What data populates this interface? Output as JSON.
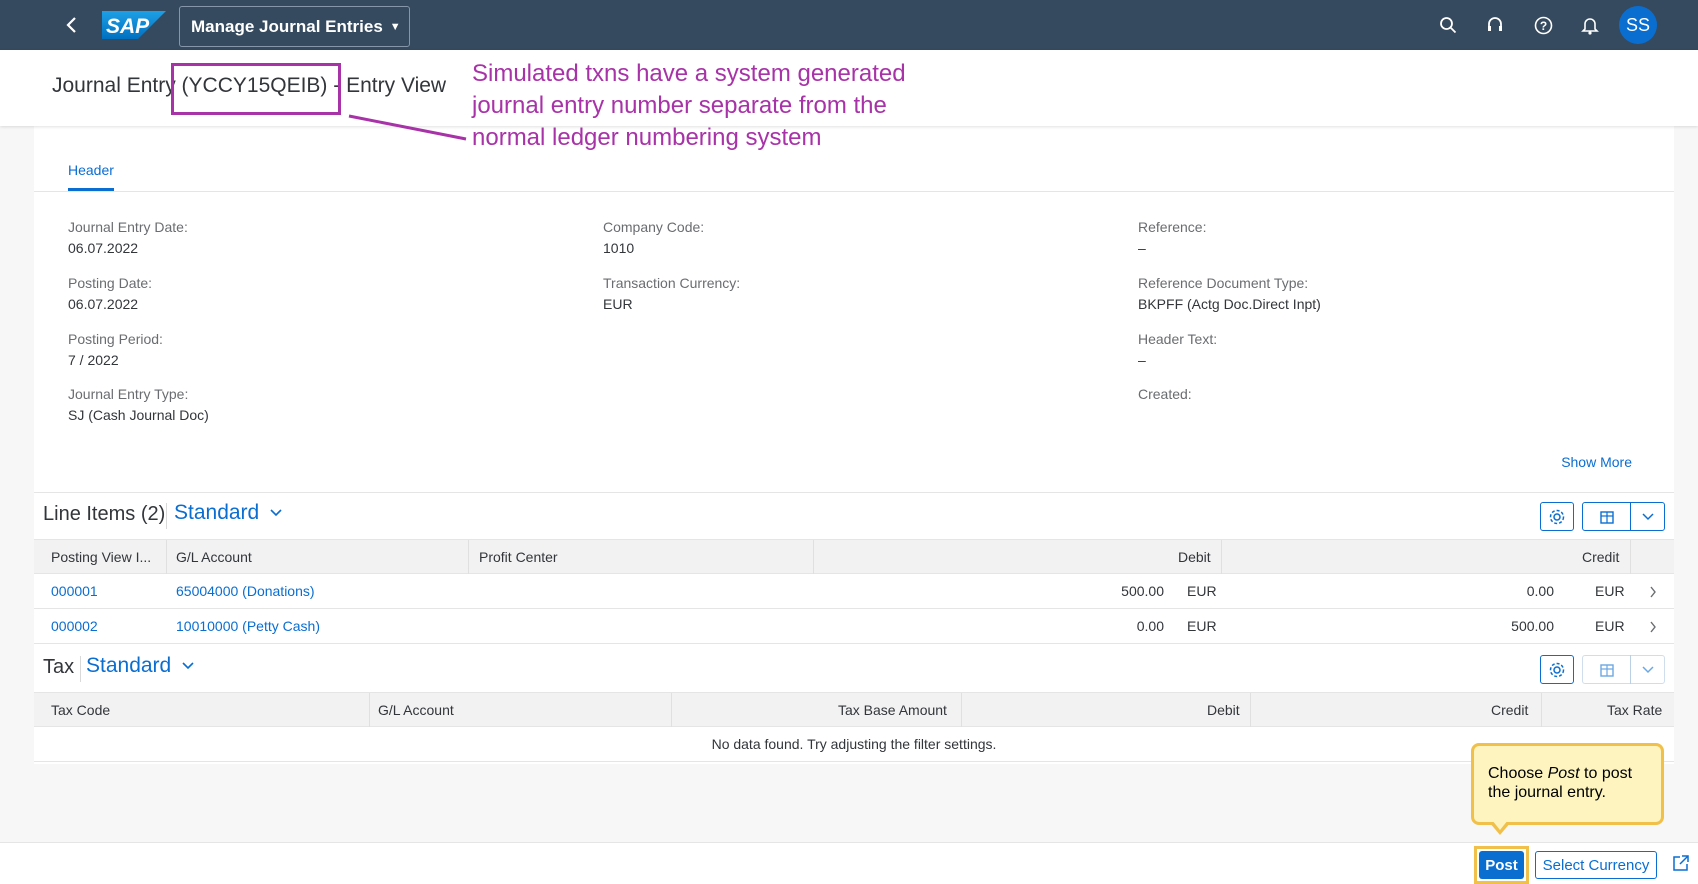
{
  "shell": {
    "app_title": "Manage Journal Entries",
    "logo_text": "SAP",
    "avatar_initials": "SS"
  },
  "page": {
    "title": "Journal Entry (YCCY15QEIB) - Entry View"
  },
  "annotation": {
    "text": "Simulated txns have a system generated journal entry number separate from the normal ledger numbering system"
  },
  "header_tab": {
    "label": "Header"
  },
  "fields": {
    "col1": [
      {
        "label": "Journal Entry Date:",
        "value": "06.07.2022"
      },
      {
        "label": "Posting Date:",
        "value": "06.07.2022"
      },
      {
        "label": "Posting Period:",
        "value": "7 / 2022"
      },
      {
        "label": "Journal Entry Type:",
        "value": "SJ (Cash Journal Doc)"
      }
    ],
    "col2": [
      {
        "label": "Company Code:",
        "value": "1010"
      },
      {
        "label": "Transaction Currency:",
        "value": "EUR"
      }
    ],
    "col3": [
      {
        "label": "Reference:",
        "value": "–"
      },
      {
        "label": "Reference Document Type:",
        "value": "BKPFF (Actg Doc.Direct Inpt)"
      },
      {
        "label": "Header Text:",
        "value": "–"
      },
      {
        "label": "Created:",
        "value": ""
      }
    ]
  },
  "show_more": "Show More",
  "line_items": {
    "title": "Line Items (2)",
    "variant": "Standard",
    "columns": [
      "Posting View I...",
      "G/L Account",
      "Profit Center",
      "Debit",
      "Credit"
    ],
    "rows": [
      {
        "item": "000001",
        "account": "65004000 (Donations)",
        "profit_center": "",
        "debit": "500.00",
        "debit_cur": "EUR",
        "credit": "0.00",
        "credit_cur": "EUR"
      },
      {
        "item": "000002",
        "account": "10010000 (Petty Cash)",
        "profit_center": "",
        "debit": "0.00",
        "debit_cur": "EUR",
        "credit": "500.00",
        "credit_cur": "EUR"
      }
    ]
  },
  "tax": {
    "title": "Tax",
    "variant": "Standard",
    "columns": [
      "Tax Code",
      "G/L Account",
      "Tax Base Amount",
      "Debit",
      "Credit",
      "Tax Rate"
    ],
    "empty_text": "No data found. Try adjusting the filter settings."
  },
  "tooltip": {
    "pre": "Choose ",
    "em": "Post",
    "post": " to post the journal entry."
  },
  "footer": {
    "post_label": "Post",
    "currency_label": "Select Currency"
  },
  "colors": {
    "shell_bg": "#354a5f",
    "accent": "#0a6ed1",
    "annotation": "#a832a8",
    "tip_bg": "#fdf4bf",
    "tip_border": "#f0c04a"
  }
}
